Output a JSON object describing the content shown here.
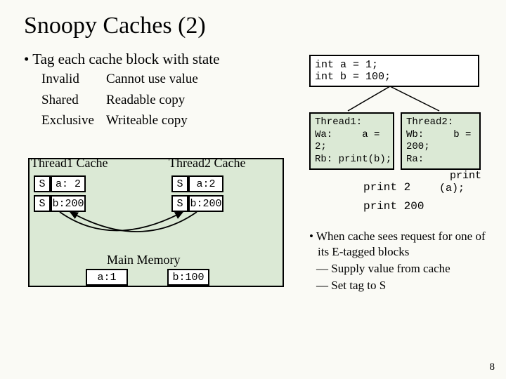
{
  "title": "Snoopy Caches (2)",
  "bullet": "Tag each cache block with state",
  "states": [
    {
      "name": "Invalid",
      "desc": "Cannot use value"
    },
    {
      "name": "Shared",
      "desc": "Readable copy"
    },
    {
      "name": "Exclusive",
      "desc": "Writeable copy"
    }
  ],
  "codebox": "int a = 1;\nint b = 100;",
  "thread1box": "Thread1:\nWa:     a =\n2;\nRb: print(b);",
  "thread2box": "Thread2:\nWb:     b =\n200;\nRa:",
  "frag_print": "print",
  "frag_a": "(a);",
  "out1": "print 2",
  "out2": "print 200",
  "labels": {
    "cache1": "Thread1 Cache",
    "cache2": "Thread2 Cache",
    "mem": "Main Memory"
  },
  "cells": {
    "s1a": "S",
    "d1a": "a: 2",
    "s1b": "S",
    "d1b": "b:200",
    "s2a": "S",
    "d2a": "a:2",
    "s2b": "S",
    "d2b": "b:200",
    "ma": "a:1",
    "mb": "b:100"
  },
  "right": {
    "l1": "When cache sees request for one of its E-tagged blocks",
    "l2": "Supply value from cache",
    "l3": "Set tag to S"
  },
  "slide": "8"
}
